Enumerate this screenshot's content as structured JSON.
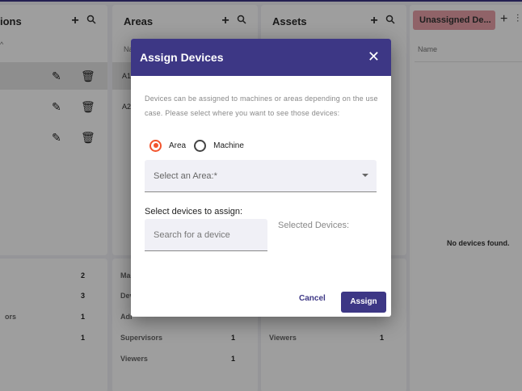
{
  "panels": {
    "locations": {
      "title": "ions",
      "sort_label": "^"
    },
    "areas": {
      "title": "Areas",
      "col_name": "Na",
      "rows": [
        "A1",
        "A2"
      ]
    },
    "assets": {
      "title": "Assets"
    },
    "unassigned": {
      "title": "Unassigned De...",
      "col_name": "Name",
      "empty": "No devices found."
    }
  },
  "stats": {
    "locations": [
      {
        "label": "",
        "value": "2"
      },
      {
        "label": "",
        "value": "3"
      },
      {
        "label": "ors",
        "value": "1"
      },
      {
        "label": "",
        "value": "1"
      }
    ],
    "areas": [
      {
        "label": "Mac",
        "value": ""
      },
      {
        "label": "Dev",
        "value": ""
      },
      {
        "label": "Adr",
        "value": ""
      },
      {
        "label": "Supervisors",
        "value": "1"
      },
      {
        "label": "Viewers",
        "value": "1"
      }
    ],
    "assets": [
      {
        "label": "Viewers",
        "value": "1"
      }
    ]
  },
  "dialog": {
    "title": "Assign Devices",
    "description": "Devices can be assigned to machines or areas depending on the use case. Please select where you want to see those devices:",
    "radio_area": "Area",
    "radio_machine": "Machine",
    "select_placeholder": "Select an Area:*",
    "assign_label": "Select devices to assign:",
    "search_placeholder": "Search for a device",
    "selected_label": "Selected Devices:",
    "cancel_label": "Cancel",
    "assign_button": "Assign"
  },
  "colors": {
    "primary": "#3d3785",
    "accent": "#f2542d",
    "unassigned_tab": "#e8a0a8"
  }
}
